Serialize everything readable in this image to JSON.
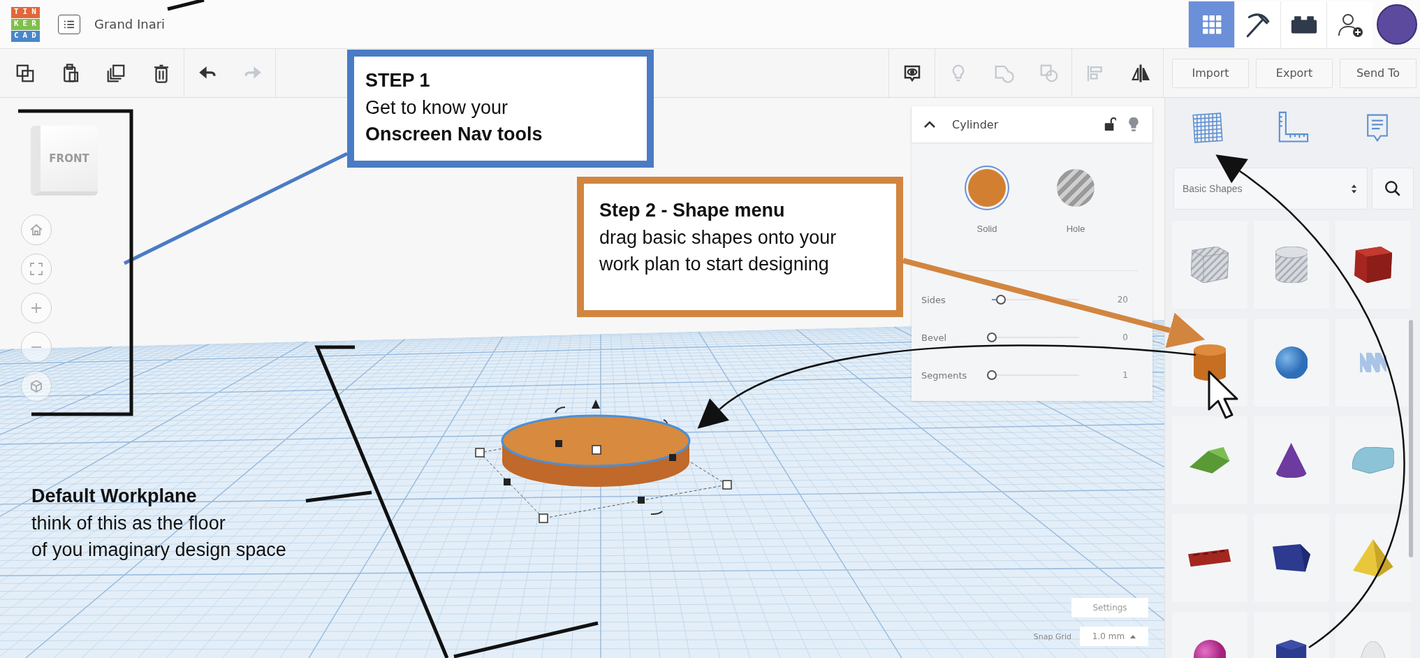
{
  "top_bar": {
    "logo": [
      "TIN",
      "KER",
      "CAD"
    ],
    "project_title": "Grand Inari",
    "view_modes": [
      {
        "selected": true
      },
      {
        "selected": false
      },
      {
        "selected": false
      }
    ]
  },
  "toolbar": {
    "edit_tools": [
      {
        "disabled": false
      },
      {
        "disabled": false
      },
      {
        "disabled": false
      },
      {
        "disabled": false
      },
      {
        "disabled": false
      },
      {
        "disabled": true
      }
    ],
    "shape_tools": [
      {
        "disabled": false
      },
      {
        "disabled": true
      },
      {
        "disabled": true
      },
      {
        "disabled": true
      },
      {
        "disabled": true
      },
      {
        "disabled": false
      }
    ],
    "buttons": [
      "Import",
      "Export",
      "Send To"
    ]
  },
  "nav_tools": {
    "view_cube_label": "FRONT"
  },
  "inspector": {
    "title": "Cylinder",
    "materials": [
      {
        "label": "Solid",
        "selected": true
      },
      {
        "label": "Hole",
        "selected": false
      }
    ],
    "parameters": [
      {
        "label": "Sides",
        "value": "20",
        "level": 0.1
      },
      {
        "label": "Bevel",
        "value": "0",
        "level": 0
      },
      {
        "label": "Segments",
        "value": "1",
        "level": 0
      }
    ]
  },
  "workplane": {
    "settings_button": "Settings",
    "snap_grid_label": "Snap Grid",
    "snap_grid_value": "1.0 mm"
  },
  "shapes_panel": {
    "category": "Basic Shapes"
  },
  "callouts": [
    {
      "kind": "boxed",
      "title": "STEP 1",
      "text": "Get to know your\n**Onscreen Nav tools**",
      "color": "#4a7bc4"
    },
    {
      "kind": "boxed",
      "title": "Step 2 - Shape menu",
      "text": "drag basic shapes onto your work plan to start designing",
      "color": "#d2853f"
    },
    {
      "kind": "plain",
      "title": "Default Workplane",
      "text": "think of this as the floor\nof you imaginary design space"
    }
  ]
}
